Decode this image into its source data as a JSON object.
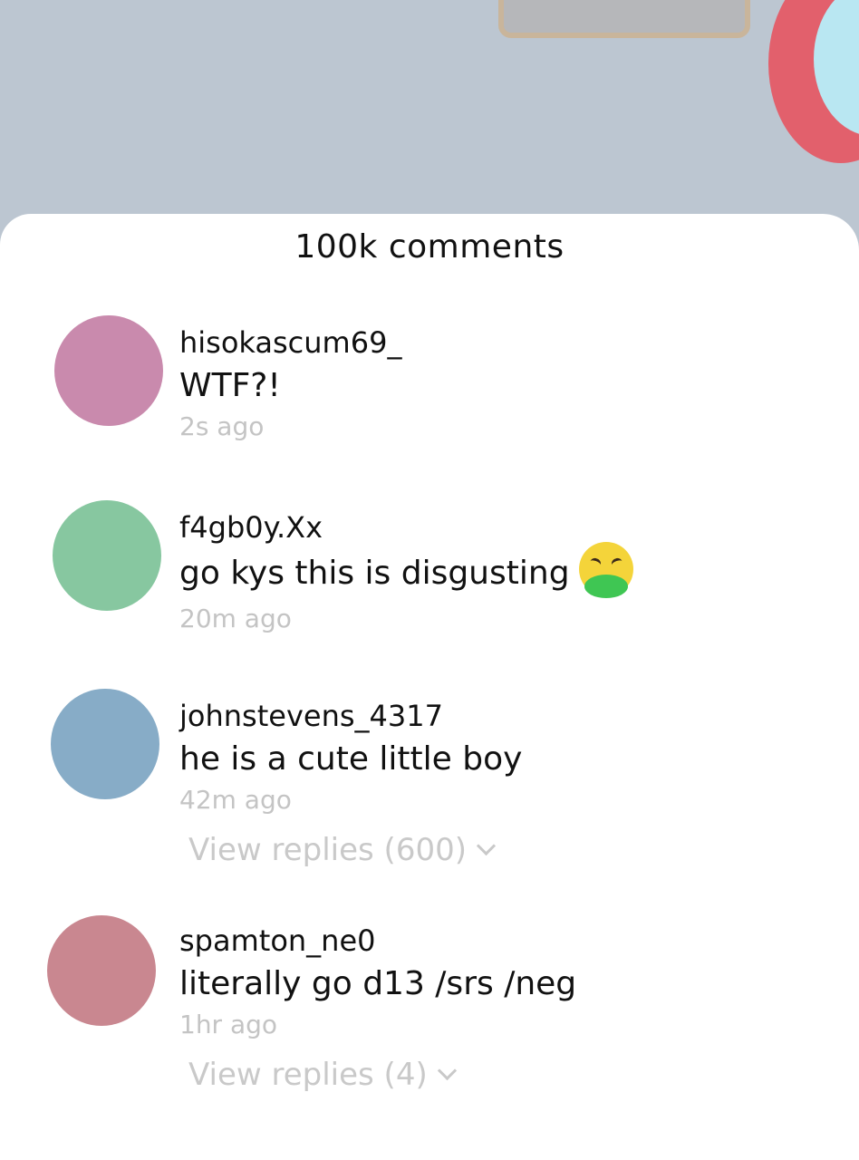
{
  "header": {
    "comment_count": "100k comments"
  },
  "comments": [
    {
      "username": "hisokascum69_",
      "text": "WTF?!",
      "time": "2s ago",
      "avatar_color": "#c98aad"
    },
    {
      "username": "f4gb0y.Xx",
      "text": "go kys this is disgusting",
      "emoji": "vomiting-face-icon",
      "time": "20m ago",
      "avatar_color": "#87c7a0"
    },
    {
      "username": "johnstevens_4317",
      "text": "he is a cute little boy",
      "time": "42m ago",
      "replies": "View replies (600)",
      "avatar_color": "#87acc7"
    },
    {
      "username": "spamton_ne0",
      "text": "literally go d13 /srs /neg",
      "time": "1hr ago",
      "replies": "View replies (4)",
      "avatar_color": "#c98790"
    }
  ],
  "colors": {
    "background": "#bcc6d1",
    "sheet": "#ffffff",
    "muted_text": "#c4c4c4"
  }
}
